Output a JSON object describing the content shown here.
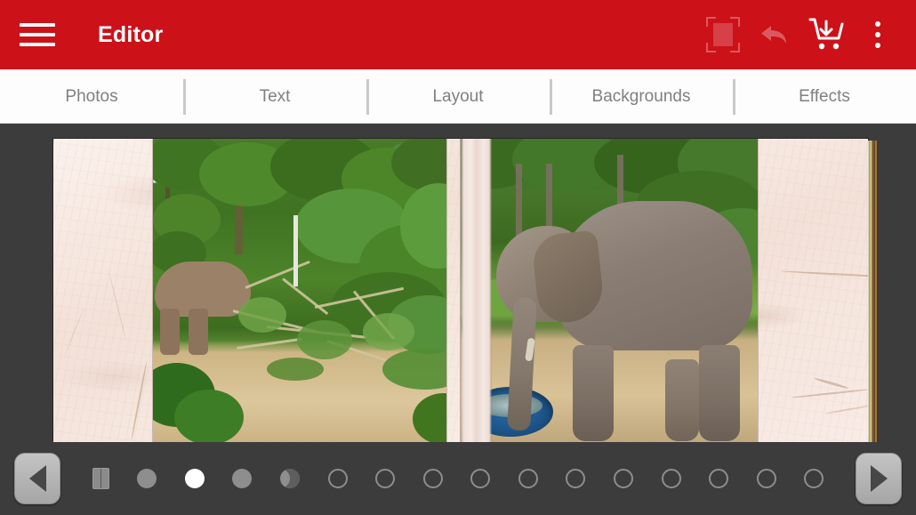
{
  "appbar": {
    "menu_icon": "hamburger-menu-icon",
    "title": "Editor",
    "actions": [
      {
        "icon": "crop-frame-icon",
        "state": "disabled"
      },
      {
        "icon": "undo-arrow-icon",
        "state": "disabled"
      },
      {
        "icon": "cart-download-icon",
        "state": "enabled"
      },
      {
        "icon": "overflow-menu-icon",
        "state": "enabled"
      }
    ],
    "background_color": "#cc1119",
    "title_color": "#ffffff"
  },
  "tabs": [
    {
      "label": "Photos",
      "selected": false
    },
    {
      "label": "Text",
      "selected": false
    },
    {
      "label": "Layout",
      "selected": false
    },
    {
      "label": "Backgrounds",
      "selected": false
    },
    {
      "label": "Effects",
      "selected": false
    }
  ],
  "canvas": {
    "background_color": "#3c3c3c",
    "page_color": "#f6e7e0",
    "spine_color": "#b9a85e",
    "left_page": {
      "photo_alt": "elephant standing among dense green jungle foliage and dry brush on sandy ground"
    },
    "right_page": {
      "photo_alt": "large gray elephant in profile dipping its trunk into a blue plastic basin of water on a sandy yard"
    }
  },
  "pagestrip": {
    "prev_label": "◀",
    "next_label": "▶",
    "active_index": 2,
    "dots": [
      {
        "style": "cover"
      },
      {
        "style": "filled"
      },
      {
        "style": "active"
      },
      {
        "style": "filled"
      },
      {
        "style": "half"
      },
      {
        "style": "hollow"
      },
      {
        "style": "hollow"
      },
      {
        "style": "hollow"
      },
      {
        "style": "hollow"
      },
      {
        "style": "hollow"
      },
      {
        "style": "hollow"
      },
      {
        "style": "hollow"
      },
      {
        "style": "hollow"
      },
      {
        "style": "hollow"
      },
      {
        "style": "hollow"
      },
      {
        "style": "hollow"
      }
    ]
  }
}
